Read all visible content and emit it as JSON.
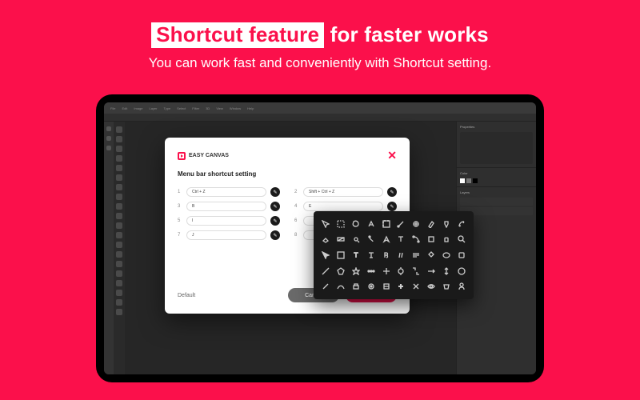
{
  "hero": {
    "highlight": "Shortcut feature",
    "rest": " for faster works",
    "subtitle": "You can work fast and conveniently with Shortcut setting."
  },
  "app": {
    "menu": [
      "File",
      "Edit",
      "Image",
      "Layer",
      "Type",
      "Select",
      "Filter",
      "3D",
      "View",
      "Window",
      "Help"
    ],
    "right_panels": {
      "p1": [
        "Properties"
      ],
      "p2": [
        "Color"
      ],
      "p3": [
        "Layers"
      ]
    }
  },
  "modal": {
    "brand": "EASY CANVAS",
    "close": "✕",
    "title": "Menu bar shortcut setting",
    "rows": [
      {
        "n": "1",
        "value": "Ctrl + Z"
      },
      {
        "n": "2",
        "value": "Shift + Ctrl + Z"
      },
      {
        "n": "3",
        "value": "B"
      },
      {
        "n": "4",
        "value": "E"
      },
      {
        "n": "5",
        "value": "I"
      },
      {
        "n": "6",
        "value": ""
      },
      {
        "n": "7",
        "value": "J"
      },
      {
        "n": "8",
        "value": ""
      }
    ],
    "default": "Default",
    "cancel": "Cancel",
    "ok": "OK"
  },
  "picker": {
    "items": [
      "move",
      "marquee",
      "lasso",
      "wand",
      "crop",
      "eyedropper",
      "heal",
      "brush",
      "stamp",
      "history",
      "eraser",
      "gradient",
      "blur",
      "dodge",
      "pen",
      "type",
      "path",
      "rect",
      "hand",
      "zoom",
      "arrow",
      "select",
      "text",
      "type2",
      "bold",
      "italic",
      "align",
      "shape",
      "ellipse",
      "rect2",
      "line",
      "polygon",
      "custom",
      "more",
      "move2",
      "rotate",
      "scale",
      "flip",
      "mirror",
      "tool",
      "a",
      "b",
      "c",
      "d",
      "e",
      "f",
      "g",
      "h",
      "i",
      "j"
    ]
  }
}
